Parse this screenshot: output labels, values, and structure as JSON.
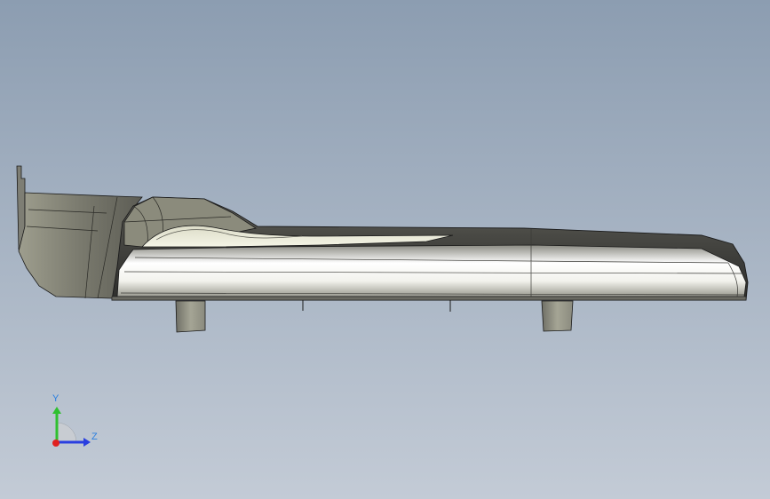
{
  "viewport": {
    "background_top": "#8c9db1",
    "background_bottom": "#c3cbd6"
  },
  "model": {
    "shade_dark": "#3d3d3a",
    "shade_mid": "#7a7a70",
    "shade_light": "#b8b8a8",
    "highlight": "#ffffff",
    "edge": "#1a1a1a"
  },
  "triad": {
    "y_label": "Y",
    "z_label": "Z",
    "y_color": "#2fc02f",
    "z_color": "#2a3fe0",
    "x_color": "#e02020",
    "label_color": "#2a7fe0"
  }
}
